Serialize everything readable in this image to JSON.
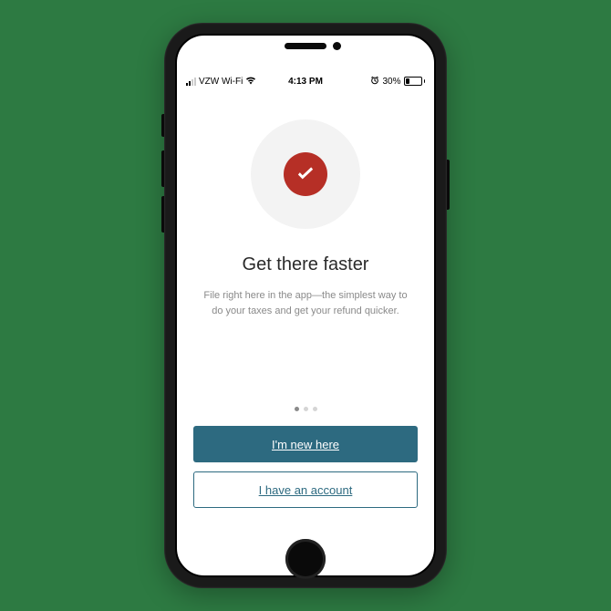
{
  "status_bar": {
    "carrier": "VZW Wi-Fi",
    "time": "4:13 PM",
    "battery_percent": "30%"
  },
  "onboarding": {
    "headline": "Get there faster",
    "subtext": "File right here in the app—the simplest way to do your taxes and get your refund quicker."
  },
  "buttons": {
    "primary": "I'm new here",
    "secondary": "I have an account"
  },
  "pagination": {
    "count": 3,
    "active_index": 0
  },
  "icons": {
    "logo": "checkmark-circle-red",
    "alarm": "alarm-icon",
    "wifi": "wifi-icon",
    "signal": "signal-bars"
  }
}
